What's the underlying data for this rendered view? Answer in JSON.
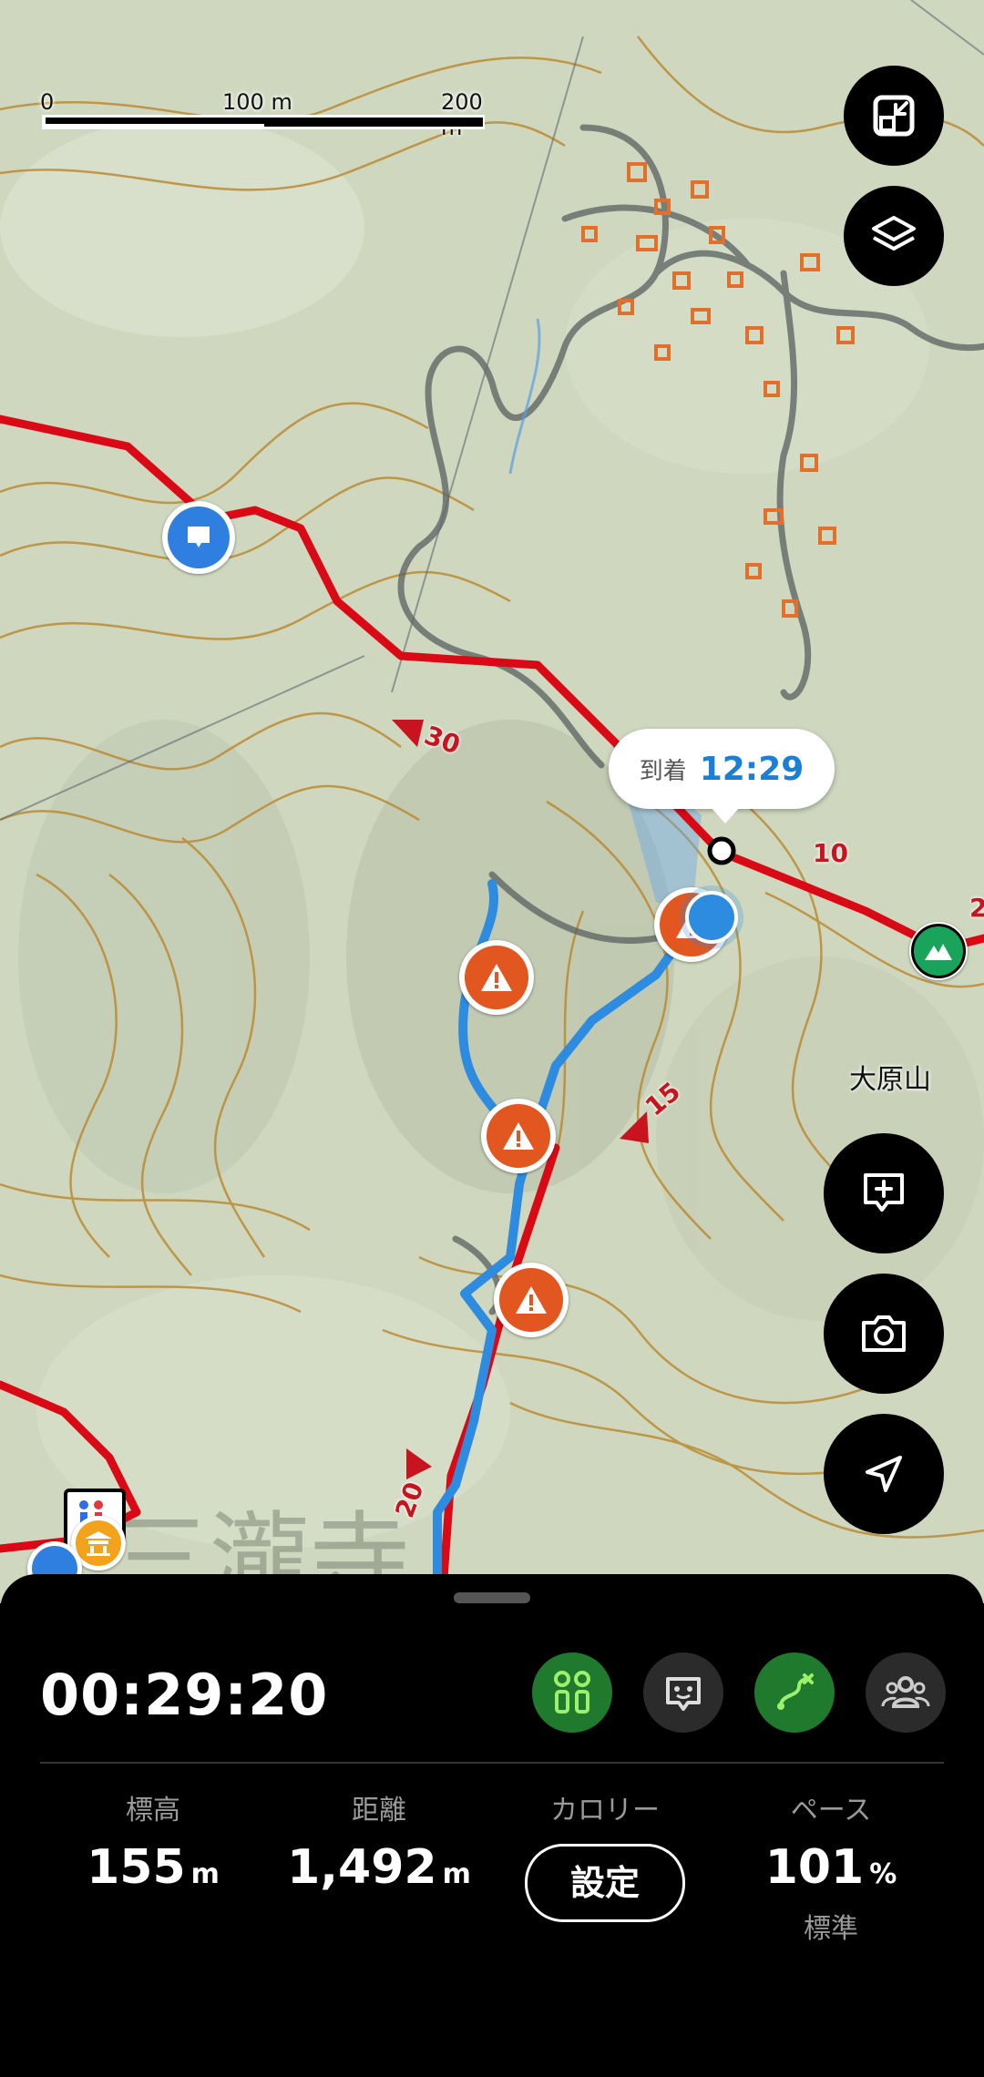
{
  "map": {
    "scale": {
      "label_0": "0",
      "label_100": "100 m",
      "label_200": "200 m"
    },
    "place_label": "大原山",
    "temple_label": "三瀧寺",
    "arrival": {
      "label": "到着",
      "time": "12:29"
    },
    "km_markers": [
      "30",
      "10",
      "15",
      "20",
      "2"
    ],
    "colors": {
      "route": "#d90a16",
      "track": "#2d8be0",
      "warning": "#e2561f",
      "summit": "#1aa35a",
      "contour": "#b9862a"
    }
  },
  "buttons": {
    "fullscreen_icon": "fullscreen-icon",
    "layers_icon": "layers-icon",
    "add_memo_icon": "add-memo-icon",
    "camera_icon": "camera-icon",
    "navigation_icon": "navigation-icon"
  },
  "panel": {
    "elapsed": "00:29:20",
    "toolbar_icons": [
      "altitude-marker-icon",
      "face-icon",
      "route-icon",
      "group-icon"
    ],
    "stats": {
      "elevation": {
        "label": "標高",
        "value": "155",
        "unit": "m"
      },
      "distance": {
        "label": "距離",
        "value": "1,492",
        "unit": "m"
      },
      "calories": {
        "label": "カロリー",
        "button": "設定"
      },
      "pace": {
        "label": "ペース",
        "value": "101",
        "unit": "%",
        "sub": "標準"
      }
    }
  }
}
